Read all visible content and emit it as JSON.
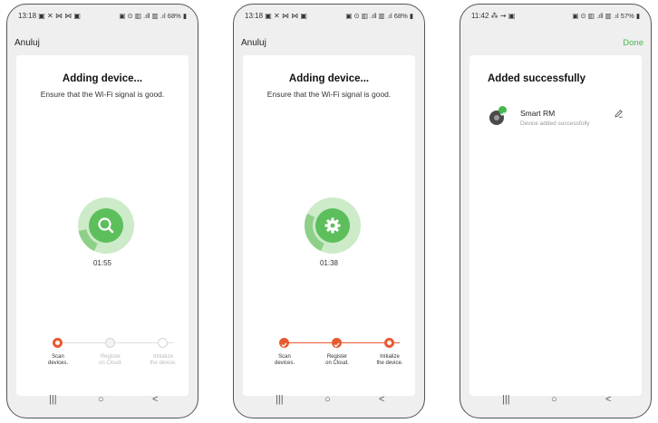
{
  "screens": [
    {
      "status_time": "13:18",
      "status_icons": "▣ ✕ ⋈ ⋈ ▣",
      "status_right": "▣ ⊙ ▥ .ıll ▥ .ıl 68% ▮",
      "cancel_label": "Anuluj",
      "title": "Adding device...",
      "subtitle": "Ensure that the Wi-Fi signal is good.",
      "center_icon": "search-icon",
      "timer": "01:55",
      "progress": 0.15,
      "steps": [
        {
          "label_line1": "Scan",
          "label_line2": "devices.",
          "state": "active"
        },
        {
          "label_line1": "Register",
          "label_line2": "on Cloud.",
          "state": "pending"
        },
        {
          "label_line1": "Initialize",
          "label_line2": "the device.",
          "state": "pending"
        }
      ],
      "nav": [
        "|||",
        "○",
        "<"
      ]
    },
    {
      "status_time": "13:18",
      "status_icons": "▣ ✕ ⋈ ⋈ ▣",
      "status_right": "▣ ⊙ ▥ .ıll ▥ .ıl 68% ▮",
      "cancel_label": "Anuluj",
      "title": "Adding device...",
      "subtitle": "Ensure that the Wi-Fi signal is good.",
      "center_icon": "gear-icon",
      "timer": "01:38",
      "progress": 0.25,
      "steps": [
        {
          "label_line1": "Scan",
          "label_line2": "devices.",
          "state": "done"
        },
        {
          "label_line1": "Register",
          "label_line2": "on Cloud.",
          "state": "done"
        },
        {
          "label_line1": "Initialize",
          "label_line2": "the device.",
          "state": "active"
        }
      ],
      "nav": [
        "|||",
        "○",
        "<"
      ]
    },
    {
      "status_time": "11:42",
      "status_icons": "⁂ ⇝ ▣",
      "status_right": "▣ ⊙ ▥ .ıll ▥ .ıl 57% ▮",
      "done_label": "Done",
      "title": "Added successfully",
      "device_name": "Smart RM",
      "device_status": "Device added successfully",
      "nav": [
        "|||",
        "○",
        "<"
      ]
    }
  ],
  "colors": {
    "accent_orange": "#e9592f",
    "accent_green": "#46b94e",
    "ring_light": "#cdeac9",
    "ring_mid": "#8ed088"
  }
}
